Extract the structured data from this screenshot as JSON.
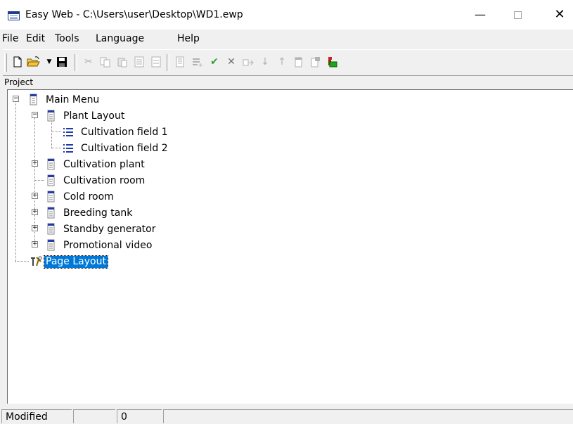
{
  "window": {
    "title": "Easy Web - C:\\Users\\user\\Desktop\\WD1.ewp",
    "minimize_glyph": "—",
    "close_glyph": "✕"
  },
  "menu": [
    "File",
    "Edit",
    "Tools",
    "Language",
    "Help"
  ],
  "toolbar": {
    "buttons": [
      {
        "name": "new-icon",
        "enabled": true
      },
      {
        "name": "open-folder-icon",
        "enabled": true
      },
      {
        "name": "dropdown-arrow-icon",
        "enabled": true
      },
      {
        "name": "save-icon",
        "enabled": true
      },
      {
        "name": "cut-icon",
        "enabled": false
      },
      {
        "name": "copy-icon",
        "enabled": false
      },
      {
        "name": "paste-icon",
        "enabled": false
      },
      {
        "name": "insert-page-icon",
        "enabled": false
      },
      {
        "name": "delete-page-icon",
        "enabled": false
      },
      {
        "name": "properties-icon",
        "enabled": false
      },
      {
        "name": "list-add-icon",
        "enabled": false
      },
      {
        "name": "check-icon",
        "enabled": true
      },
      {
        "name": "cancel-x-icon",
        "enabled": true
      },
      {
        "name": "move-icon",
        "enabled": false
      },
      {
        "name": "move-down-icon",
        "enabled": false
      },
      {
        "name": "move-up-icon",
        "enabled": false
      },
      {
        "name": "add-menu-icon",
        "enabled": false
      },
      {
        "name": "remove-menu-icon",
        "enabled": false
      },
      {
        "name": "page-color-icon",
        "enabled": true
      }
    ],
    "check_glyph": "✔",
    "x_glyph": "✕",
    "arrow_down_glyph": "▼",
    "move_down_glyph": "↓",
    "move_up_glyph": "↑",
    "cut_glyph": "✂"
  },
  "project_label": "Project",
  "tree": {
    "main_menu": "Main Menu",
    "plant_layout": "Plant Layout",
    "cultivation_field_1": "Cultivation field 1",
    "cultivation_field_2": "Cultivation field 2",
    "cultivation_plant": "Cultivation plant",
    "cultivation_room": "Cultivation room",
    "cold_room": "Cold room",
    "breeding_tank": "Breeding tank",
    "standby_generator": "Standby generator",
    "promotional_video": "Promotional video",
    "page_layout": "Page Layout",
    "expanded_sign": "−",
    "collapsed_sign": "+"
  },
  "status": {
    "state": "Modified",
    "panel2": "",
    "count": "0"
  },
  "colors": {
    "selection": "#0078d7",
    "menu_icon_blue": "#1f3ca8"
  }
}
